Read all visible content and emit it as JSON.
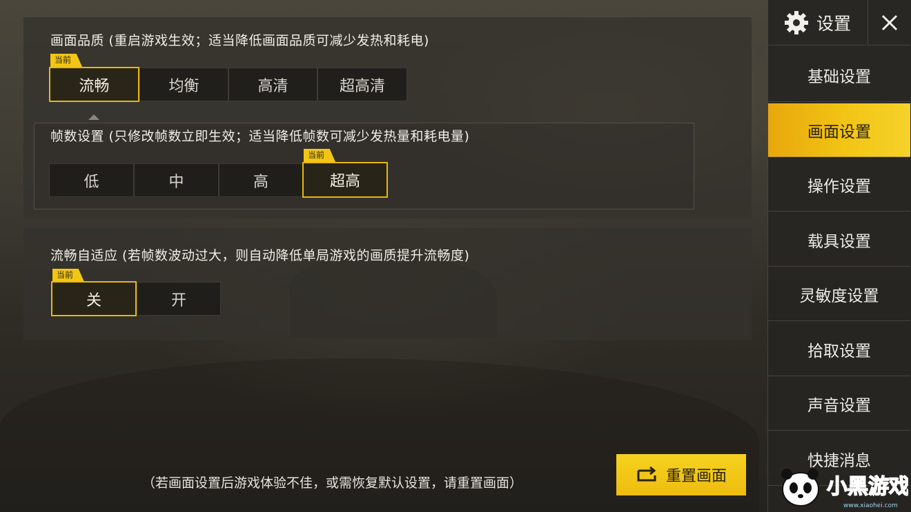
{
  "sidebar": {
    "title": "设置",
    "items": [
      {
        "label": "基础设置"
      },
      {
        "label": "画面设置",
        "active": true
      },
      {
        "label": "操作设置"
      },
      {
        "label": "载具设置"
      },
      {
        "label": "灵敏度设置"
      },
      {
        "label": "拾取设置"
      },
      {
        "label": "声音设置"
      },
      {
        "label": "快捷消息"
      }
    ]
  },
  "graphics_quality": {
    "title": "画面品质 (重启游戏生效；适当降低画面品质可减少发热和耗电)",
    "current_badge": "当前",
    "options": [
      "流畅",
      "均衡",
      "高清",
      "超高清"
    ],
    "selected_index": 0
  },
  "frame_rate": {
    "title": "帧数设置 (只修改帧数立即生效；适当降低帧数可减少发热量和耗电量)",
    "current_badge": "当前",
    "options": [
      "低",
      "中",
      "高",
      "超高"
    ],
    "selected_index": 3
  },
  "adaptive": {
    "title": "流畅自适应 (若帧数波动过大，则自动降低单局游戏的画质提升流畅度)",
    "current_badge": "当前",
    "options": [
      "关",
      "开"
    ],
    "selected_index": 0
  },
  "footer": {
    "hint": "（若画面设置后游戏体验不佳，或需恢复默认设置，请重置画面）",
    "reset_label": "重置画面"
  },
  "watermark": {
    "brand": "小黑游戏",
    "url": "www.xiaohei.com"
  },
  "colors": {
    "accent": "#f2c515",
    "selected_border": "#e8b810",
    "badge": "#f3c614"
  },
  "icons": [
    "gear-icon",
    "close-icon",
    "reset-icon",
    "panda-logo-icon"
  ]
}
